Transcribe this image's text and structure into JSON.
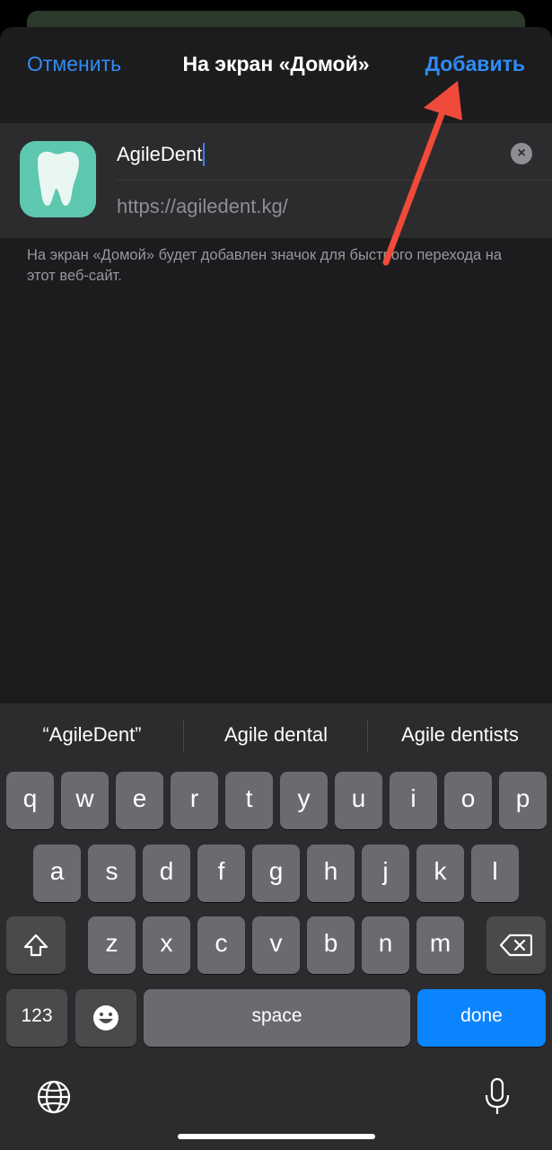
{
  "navbar": {
    "cancel_label": "Отменить",
    "title": "На экран «Домой»",
    "add_label": "Добавить"
  },
  "bookmark": {
    "name_value": "AgileDent",
    "url": "https://agiledent.kg/"
  },
  "hint_text": "На экран «Домой» будет добавлен значок для быстрого перехода на этот веб-сайт.",
  "keyboard": {
    "suggestions": [
      "“AgileDent”",
      "Agile dental",
      "Agile dentists"
    ],
    "row1": [
      "q",
      "w",
      "e",
      "r",
      "t",
      "y",
      "u",
      "i",
      "o",
      "p"
    ],
    "row2": [
      "a",
      "s",
      "d",
      "f",
      "g",
      "h",
      "j",
      "k",
      "l"
    ],
    "row3": [
      "z",
      "x",
      "c",
      "v",
      "b",
      "n",
      "m"
    ],
    "numbers_label": "123",
    "space_label": "space",
    "done_label": "done"
  },
  "icons": [
    "tooth-app-icon",
    "clear-icon",
    "shift-icon",
    "backspace-icon",
    "emoji-icon",
    "globe-icon",
    "microphone-icon"
  ],
  "colors": {
    "accent": "#2f8cf7",
    "done_key": "#0a84ff",
    "annotation_arrow": "#f04a3a",
    "app_icon_bg": "#5ec7b0"
  }
}
